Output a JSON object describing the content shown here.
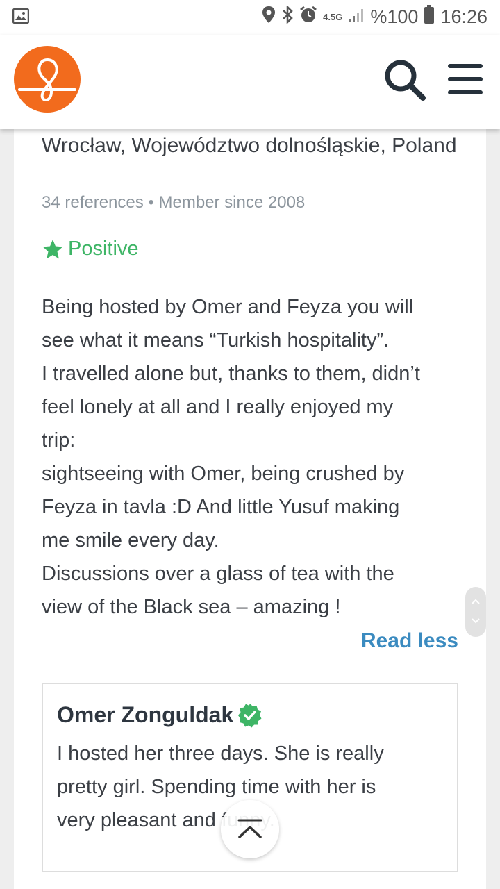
{
  "status_bar": {
    "network": "4.5G",
    "battery": "%100",
    "time": "16:26",
    "icons": [
      "image-icon",
      "location-icon",
      "bluetooth-icon",
      "alarm-icon",
      "signal-icon",
      "battery-icon"
    ]
  },
  "header": {
    "logo": "couchsurfing-logo",
    "search_icon": "search-icon",
    "menu_icon": "hamburger-menu-icon",
    "brand_color": "#f26b1d"
  },
  "reference": {
    "location": "Wrocław, Województwo dolnośląskie, Poland",
    "meta": "34 references • Member since 2008",
    "rating": "Positive",
    "rating_color": "#3eb566",
    "text_lines": [
      "Being hosted by Omer and Feyza you will",
      "see what it means “Turkish hospitality”.",
      "I travelled alone but, thanks to them, didn’t",
      "feel lonely at all and I really enjoyed my",
      "trip:",
      "sightseeing with Omer, being crushed by",
      "Feyza in tavla :D And little Yusuf making",
      "me smile every day.",
      "Discussions over a glass of tea with the",
      "view of the Black sea – amazing !"
    ],
    "read_less": "Read less",
    "link_color": "#3b8bc0"
  },
  "response": {
    "name": "Omer Zonguldak",
    "verified_icon": "verified-badge-icon",
    "text_lines": [
      "I hosted her three days. She is really",
      "pretty girl. Spending time with her is",
      "very pleasant and funny."
    ]
  },
  "back_to_top_icon": "chevron-up-bar-icon"
}
